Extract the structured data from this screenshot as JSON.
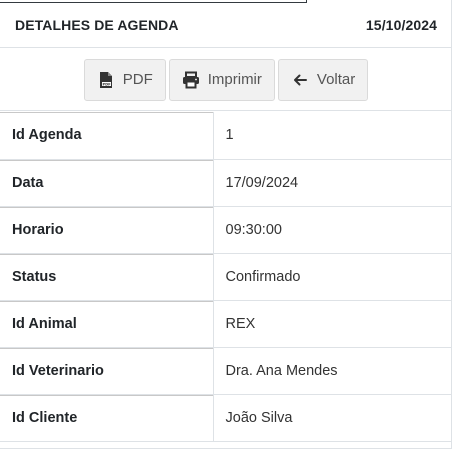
{
  "header": {
    "title": "DETALHES DE AGENDA",
    "date": "15/10/2024"
  },
  "toolbar": {
    "pdf_label": "PDF",
    "print_label": "Imprimir",
    "back_label": "Voltar",
    "pdf_icon": "pdf-file-icon",
    "print_icon": "printer-icon",
    "back_icon": "arrow-left-icon"
  },
  "details": [
    {
      "label": "Id Agenda",
      "value": "1"
    },
    {
      "label": "Data",
      "value": "17/09/2024"
    },
    {
      "label": "Horario",
      "value": "09:30:00"
    },
    {
      "label": "Status",
      "value": "Confirmado"
    },
    {
      "label": "Id Animal",
      "value": "REX"
    },
    {
      "label": "Id Veterinario",
      "value": "Dra. Ana Mendes"
    },
    {
      "label": "Id Cliente",
      "value": "João Silva"
    }
  ],
  "colors": {
    "button_bg": "#f1f1f1",
    "border": "#dee2e6",
    "text": "#212529"
  }
}
